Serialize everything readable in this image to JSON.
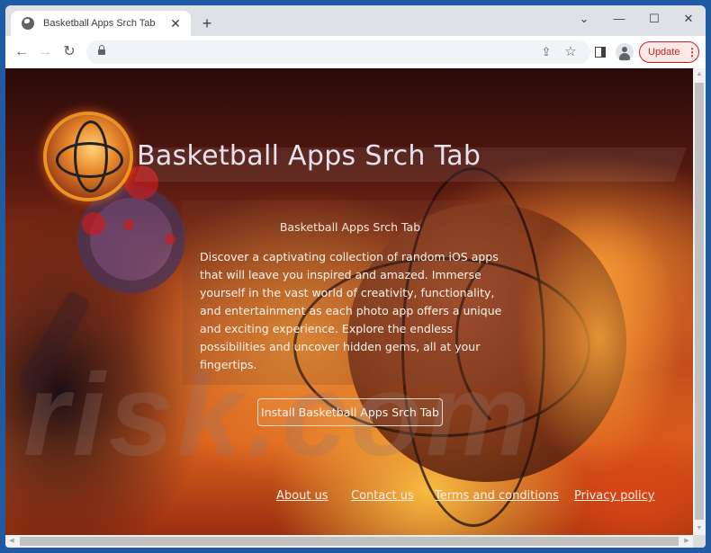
{
  "browser": {
    "tab_title": "Basketball Apps Srch Tab",
    "tab_close_glyph": "✕",
    "new_tab_glyph": "+",
    "window_controls": {
      "tab_search_glyph": "⌄",
      "minimize_glyph": "—",
      "maximize_glyph": "☐",
      "close_glyph": "✕"
    },
    "nav": {
      "back_glyph": "←",
      "forward_glyph": "→",
      "reload_glyph": "↻"
    },
    "address": {
      "url": "",
      "share_glyph": "⇪",
      "bookmark_glyph": "☆"
    },
    "update_label": "Update",
    "menu_glyph": "⋮"
  },
  "page": {
    "title": "Basketball Apps Srch Tab",
    "watermark": "risk.com",
    "info_heading": "Basketball Apps Srch Tab",
    "info_body": "Discover a captivating collection of random iOS apps that will leave you inspired and amazed. Immerse yourself in the vast world of creativity, functionality, and entertainment as each photo app offers a unique and exciting experience. Explore the endless possibilities and uncover hidden gems, all at your fingertips.",
    "install_button": "Install Basketball Apps Srch Tab",
    "footer_links": [
      {
        "label": "About us"
      },
      {
        "label": "Contact us"
      },
      {
        "label": "Terms and conditions"
      },
      {
        "label": "Privacy policy"
      }
    ]
  },
  "scrollbars": {
    "up_glyph": "▲",
    "down_glyph": "▼",
    "left_glyph": "◀",
    "right_glyph": "▶"
  },
  "colors": {
    "update_accent": "#c5221f",
    "window_frame": "#1f5aa3"
  }
}
